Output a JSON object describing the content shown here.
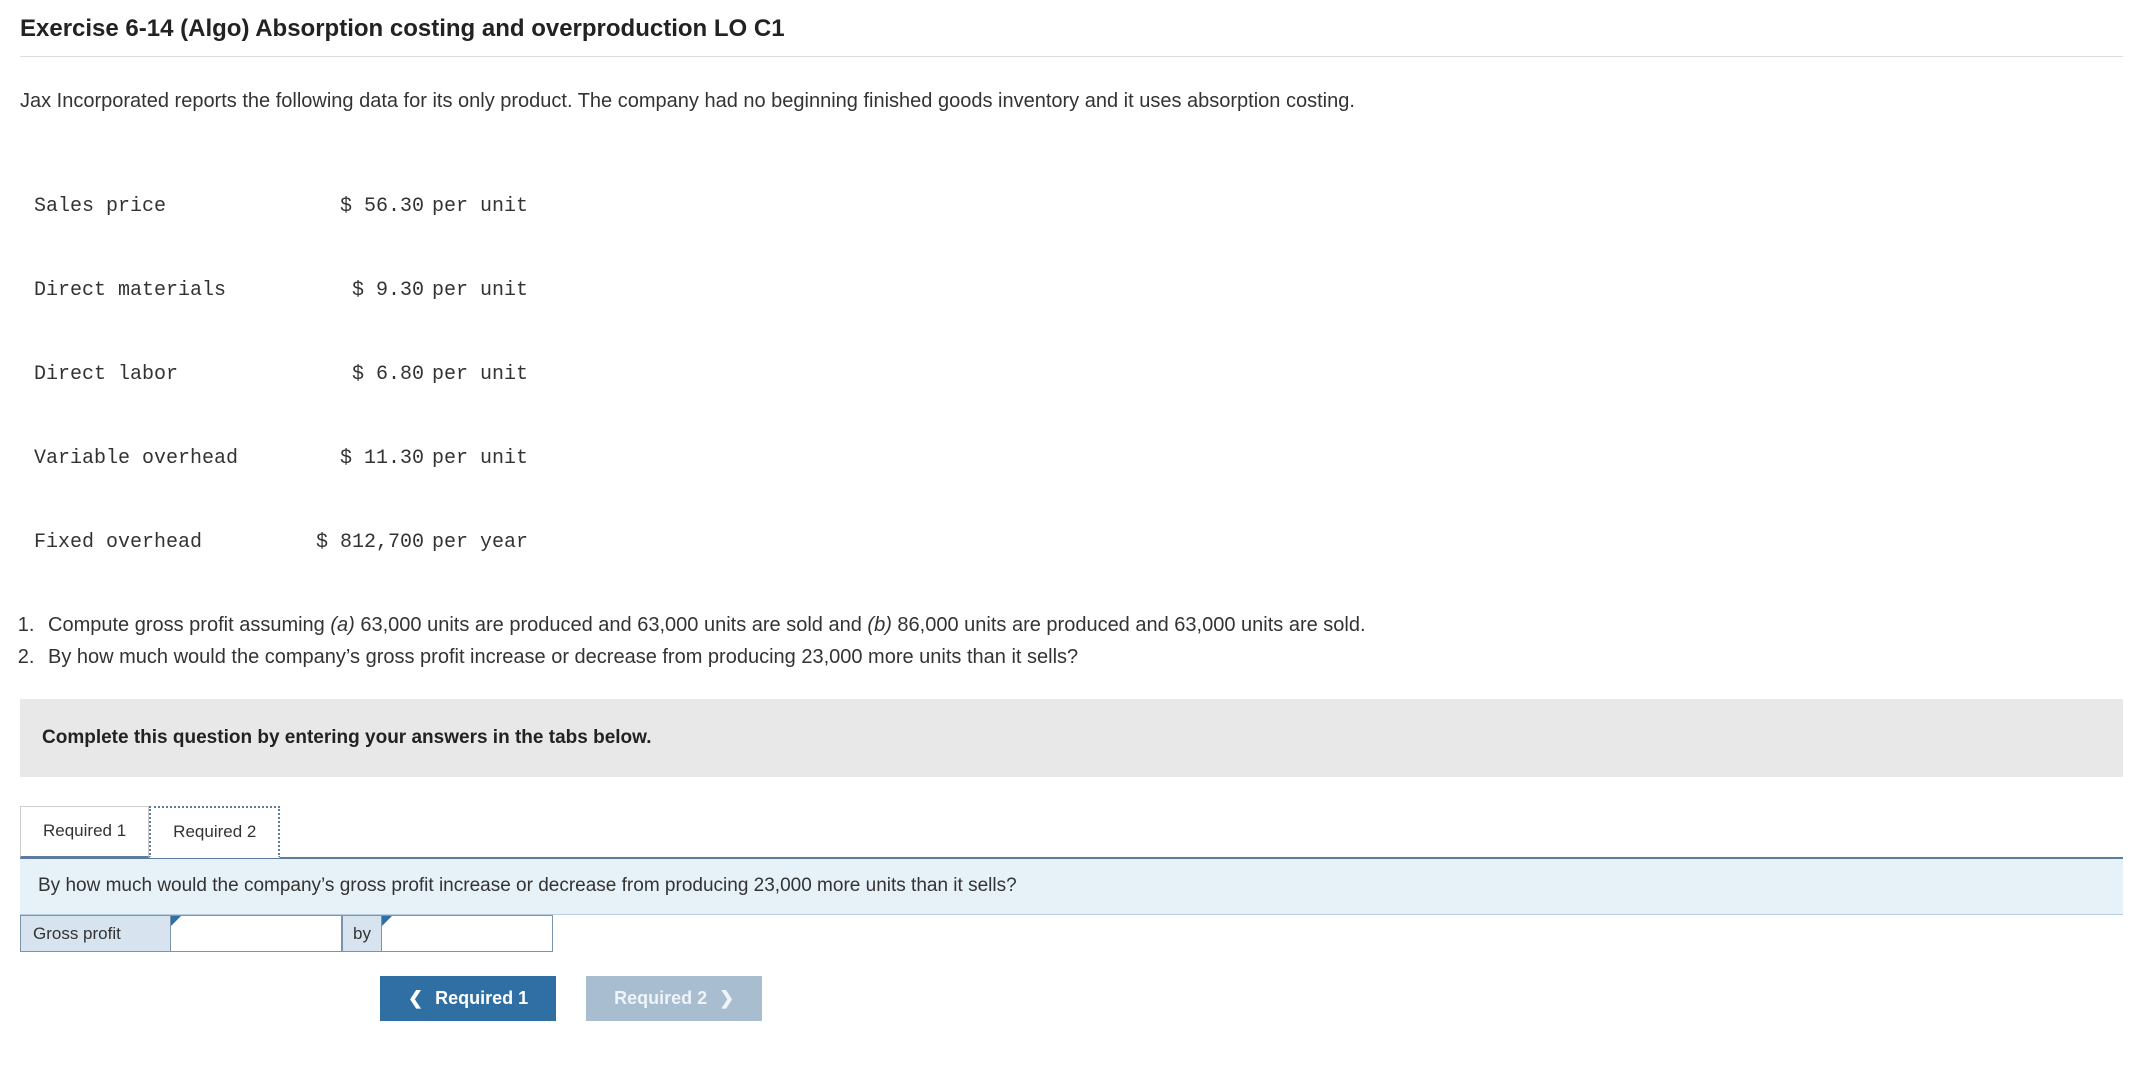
{
  "title": "Exercise 6-14 (Algo) Absorption costing and overproduction LO C1",
  "intro": "Jax Incorporated reports the following data for its only product. The company had no beginning finished goods inventory and it uses absorption costing.",
  "data": [
    {
      "label": "Sales price",
      "value": "$ 56.30",
      "unit": "per unit"
    },
    {
      "label": "Direct materials",
      "value": "$ 9.30",
      "unit": "per unit"
    },
    {
      "label": "Direct labor",
      "value": "$ 6.80",
      "unit": "per unit"
    },
    {
      "label": "Variable overhead",
      "value": "$ 11.30",
      "unit": "per unit"
    },
    {
      "label": "Fixed overhead",
      "value": "$ 812,700",
      "unit": "per year"
    }
  ],
  "questions": {
    "q1_pre": "Compute gross profit assuming ",
    "q1_a_tag": "(a)",
    "q1_a": " 63,000 units are produced and 63,000 units are sold and ",
    "q1_b_tag": "(b)",
    "q1_b": " 86,000 units are produced and 63,000 units are sold.",
    "q2": "By how much would the company’s gross profit increase or decrease from producing 23,000 more units than it sells?"
  },
  "instruction": "Complete this question by entering your answers in the tabs below.",
  "tabs": {
    "t1": "Required 1",
    "t2": "Required 2"
  },
  "panel_prompt": "By how much would the company’s gross profit increase or decrease from producing 23,000 more units than it sells?",
  "answer": {
    "label": "Gross profit",
    "by": "by",
    "field1": "",
    "field2": ""
  },
  "nav": {
    "prev": "Required 1",
    "next": "Required 2"
  }
}
